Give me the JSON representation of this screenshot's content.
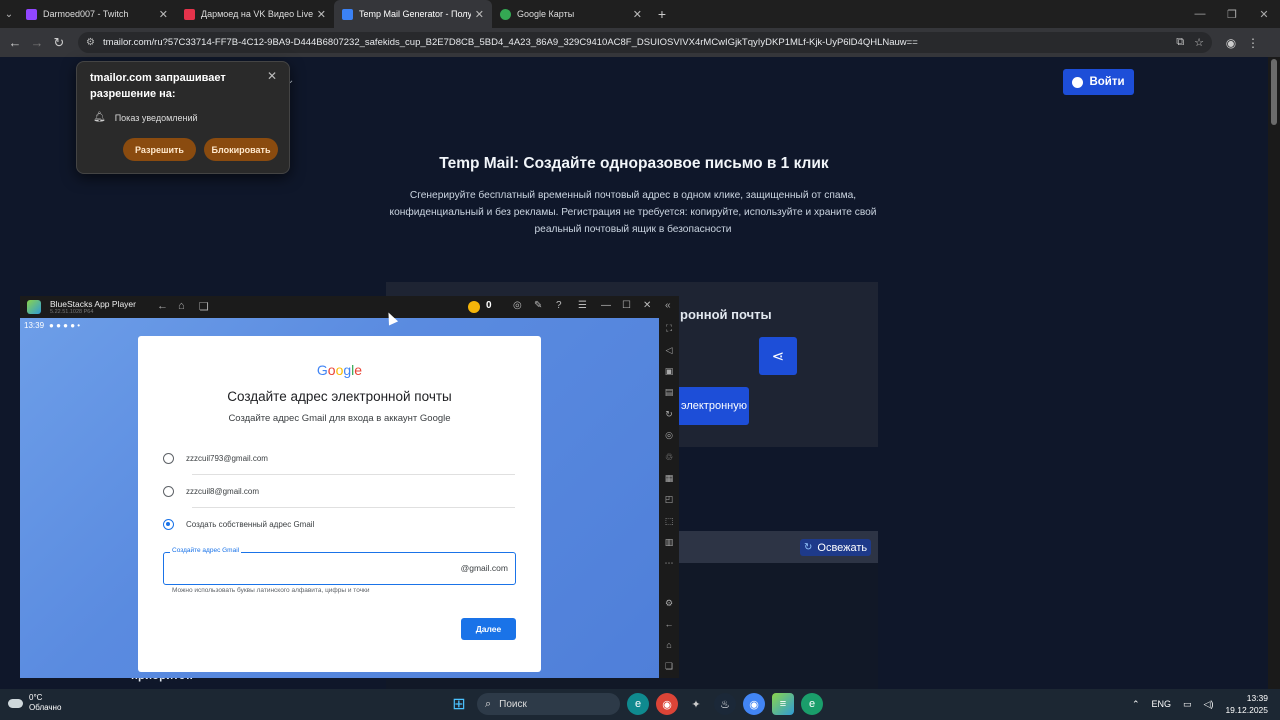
{
  "browser": {
    "tabs": [
      {
        "title": "Darmoed007 - Twitch",
        "color": "#9146ff",
        "active": false
      },
      {
        "title": "Дармоед на VK Видео Live – с",
        "color": "#e5334b",
        "active": false
      },
      {
        "title": "Temp Mail Generator - Получи",
        "color": "#3b82f6",
        "active": true
      },
      {
        "title": "Google Карты",
        "color": "#34a853",
        "active": false
      }
    ],
    "url": "tmailor.com/ru?57C33714-FF7B-4C12-9BA9-D444B6807232_safekids_cup_B2E7D8CB_5BD4_4A23_86A9_329C9410AC8F_DSUIOSVIVX4rMCwIGjkTqyIyDKP1MLf-Kjk-UyP6lD4QHLNauw=="
  },
  "permission": {
    "title": "tmailor.com запрашивает разрешение на:",
    "item": "Показ уведомлений",
    "allow": "Разрешить",
    "block": "Блокировать"
  },
  "site": {
    "login": "Войти",
    "title": "Temp Mail: Создайте одноразовое письмо в 1 клик",
    "subtitle": "Сгенерируйте бесплатный временный почтовый адрес в одном клике, защищенный от спама, конфиденциальный и без рекламы. Регистрация не требуется: копируйте, используйте и храните свой реальный почтовый ящик в безопасности",
    "card_title": "ронной почты",
    "gen_button": "электронную",
    "refresh": "Освежать",
    "priority": "приоритет."
  },
  "bluestacks": {
    "name": "BlueStacks App Player",
    "version": "5.22.51.1028 P64",
    "coins": "0",
    "status_time": "13:39"
  },
  "google_dialog": {
    "logo": [
      "G",
      "o",
      "o",
      "g",
      "l",
      "e"
    ],
    "title": "Создайте адрес электронной почты",
    "subtitle": "Создайте адрес Gmail для входа в аккаунт Google",
    "options": [
      "zzzcuil793@gmail.com",
      "zzzcuil8@gmail.com",
      "Создать собственный адрес Gmail"
    ],
    "selected_index": 2,
    "field_label": "Создайте адрес Gmail",
    "field_suffix": "@gmail.com",
    "hint": "Можно использовать буквы латинского алфавита, цифры и точки",
    "next": "Далее"
  },
  "taskbar": {
    "temp": "0°C",
    "weather": "Облачно",
    "search": "Поиск",
    "lang": "ENG",
    "time": "13:39",
    "date": "19.12.2025"
  }
}
